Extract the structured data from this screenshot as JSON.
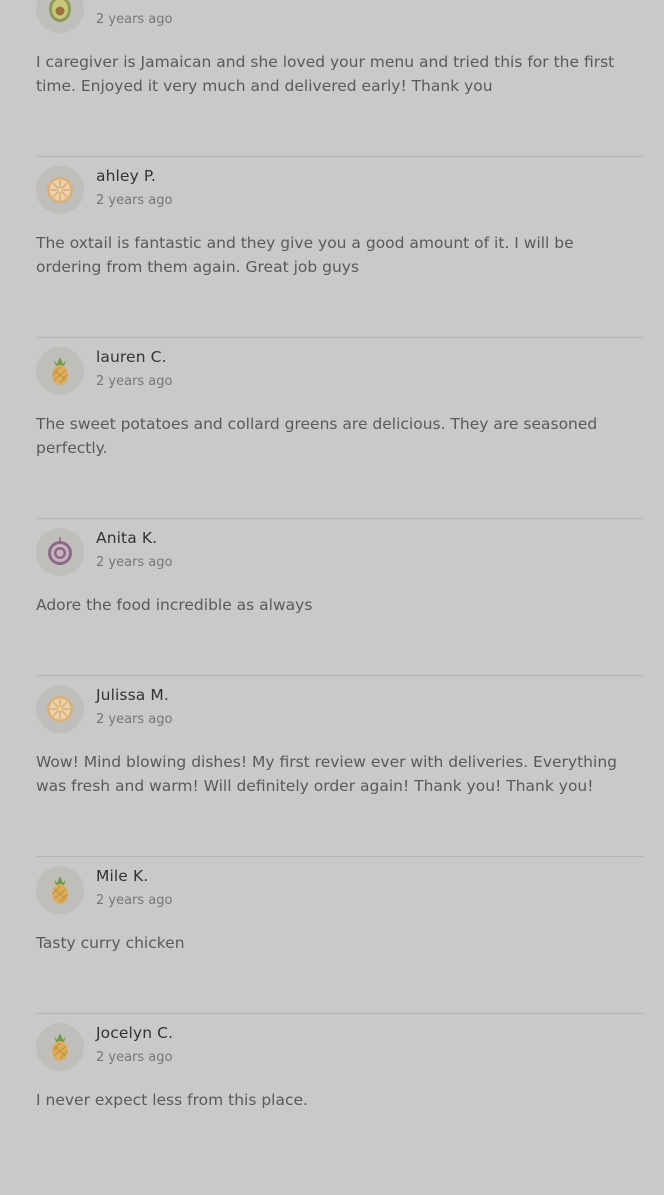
{
  "reviews": [
    {
      "name": "",
      "time": "2 years ago",
      "text": "I caregiver is Jamaican and she loved your menu and tried this for the first time. Enjoyed it very much and delivered early! Thank you",
      "avatar_icon": "avocado-icon"
    },
    {
      "name": "ahley P.",
      "time": "2 years ago",
      "text": "The oxtail is fantastic and they give you a good amount of it. I will be ordering from them again. Great job guys",
      "avatar_icon": "citrus-slice-icon"
    },
    {
      "name": "lauren C.",
      "time": "2 years ago",
      "text": "The sweet potatoes and collard greens are delicious. They are seasoned perfectly.",
      "avatar_icon": "pineapple-icon"
    },
    {
      "name": "Anita K.",
      "time": "2 years ago",
      "text": "Adore the food incredible as always",
      "avatar_icon": "onion-icon"
    },
    {
      "name": "Julissa M.",
      "time": "2 years ago",
      "text": "Wow! Mind blowing dishes! My first review ever with deliveries. Everything was fresh and warm! Will definitely order again! Thank you! Thank you!",
      "avatar_icon": "citrus-slice-icon"
    },
    {
      "name": "Mile K.",
      "time": "2 years ago",
      "text": "Tasty curry chicken",
      "avatar_icon": "pineapple-icon"
    },
    {
      "name": "Jocelyn C.",
      "time": "2 years ago",
      "text": "I never expect less from this place.",
      "avatar_icon": "pineapple-icon"
    }
  ]
}
